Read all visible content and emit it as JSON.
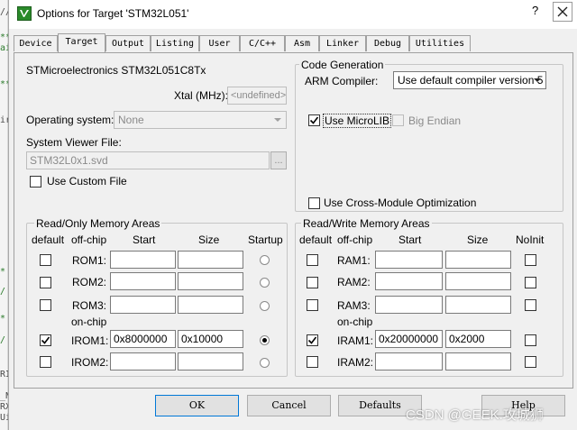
{
  "background": {
    "code_fragments": [
      "//ir",
      "**",
      "ai",
      "**",
      "ir",
      "*",
      "/",
      "*",
      "/",
      "RI",
      "_N",
      "RX",
      "Ui"
    ]
  },
  "window": {
    "title": "Options for Target 'STM32L051'",
    "help_glyph": "?",
    "icon": "keil-uvision-icon"
  },
  "tabs": [
    "Device",
    "Target",
    "Output",
    "Listing",
    "User",
    "C/C++",
    "Asm",
    "Linker",
    "Debug",
    "Utilities"
  ],
  "active_tab": "Target",
  "target": {
    "device_name": "STMicroelectronics STM32L051C8Tx",
    "xtal_label": "Xtal (MHz):",
    "xtal_value": "<undefined>",
    "os_label": "Operating system:",
    "os_value": "None",
    "svf_label": "System Viewer File:",
    "svf_value": "STM32L0x1.svd",
    "svf_browse": "...",
    "use_custom_file": "Use Custom File"
  },
  "code_generation": {
    "group_title": "Code Generation",
    "arm_compiler_label": "ARM Compiler:",
    "arm_compiler_value": "Use default compiler version 5",
    "use_microlib": "Use MicroLIB",
    "use_microlib_checked": true,
    "big_endian": "Big Endian",
    "cross_module": "Use Cross-Module Optimization"
  },
  "ro_memory": {
    "title": "Read/Only Memory Areas",
    "headers": {
      "default": "default",
      "offchip": "off-chip",
      "start": "Start",
      "size": "Size",
      "extra": "Startup"
    },
    "onchip_label": "on-chip",
    "rows": [
      {
        "name": "ROM1:",
        "start": "",
        "size": "",
        "default": false,
        "selected": false
      },
      {
        "name": "ROM2:",
        "start": "",
        "size": "",
        "default": false,
        "selected": false
      },
      {
        "name": "ROM3:",
        "start": "",
        "size": "",
        "default": false,
        "selected": false
      },
      {
        "name": "IROM1:",
        "start": "0x8000000",
        "size": "0x10000",
        "default": true,
        "selected": true
      },
      {
        "name": "IROM2:",
        "start": "",
        "size": "",
        "default": false,
        "selected": false
      }
    ]
  },
  "rw_memory": {
    "title": "Read/Write Memory Areas",
    "headers": {
      "default": "default",
      "offchip": "off-chip",
      "start": "Start",
      "size": "Size",
      "extra": "NoInit"
    },
    "onchip_label": "on-chip",
    "rows": [
      {
        "name": "RAM1:",
        "start": "",
        "size": "",
        "default": false
      },
      {
        "name": "RAM2:",
        "start": "",
        "size": "",
        "default": false
      },
      {
        "name": "RAM3:",
        "start": "",
        "size": "",
        "default": false
      },
      {
        "name": "IRAM1:",
        "start": "0x20000000",
        "size": "0x2000",
        "default": true
      },
      {
        "name": "IRAM2:",
        "start": "",
        "size": "",
        "default": false
      }
    ]
  },
  "buttons": {
    "ok": "OK",
    "cancel": "Cancel",
    "defaults": "Defaults",
    "help": "Help"
  },
  "watermark": "CSDN @GEEK.攻城狮"
}
